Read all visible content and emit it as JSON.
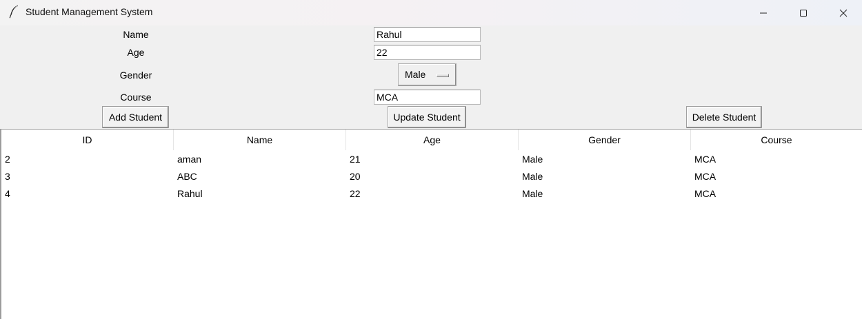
{
  "window": {
    "title": "Student Management System",
    "icon": "feather-icon",
    "controls": [
      "minimize-icon",
      "maximize-icon",
      "close-icon"
    ]
  },
  "form": {
    "name_label": "Name",
    "name_value": "Rahul",
    "age_label": "Age",
    "age_value": "22",
    "gender_label": "Gender",
    "gender_value": "Male",
    "course_label": "Course",
    "course_value": "MCA"
  },
  "buttons": {
    "add": "Add Student",
    "update": "Update Student",
    "delete": "Delete Student"
  },
  "table": {
    "columns": [
      "ID",
      "Name",
      "Age",
      "Gender",
      "Course"
    ],
    "rows": [
      [
        "2",
        "aman",
        "21",
        "Male",
        "MCA"
      ],
      [
        "3",
        "ABC",
        "20",
        "Male",
        "MCA"
      ],
      [
        "4",
        "Rahul",
        "22",
        "Male",
        "MCA"
      ]
    ]
  }
}
